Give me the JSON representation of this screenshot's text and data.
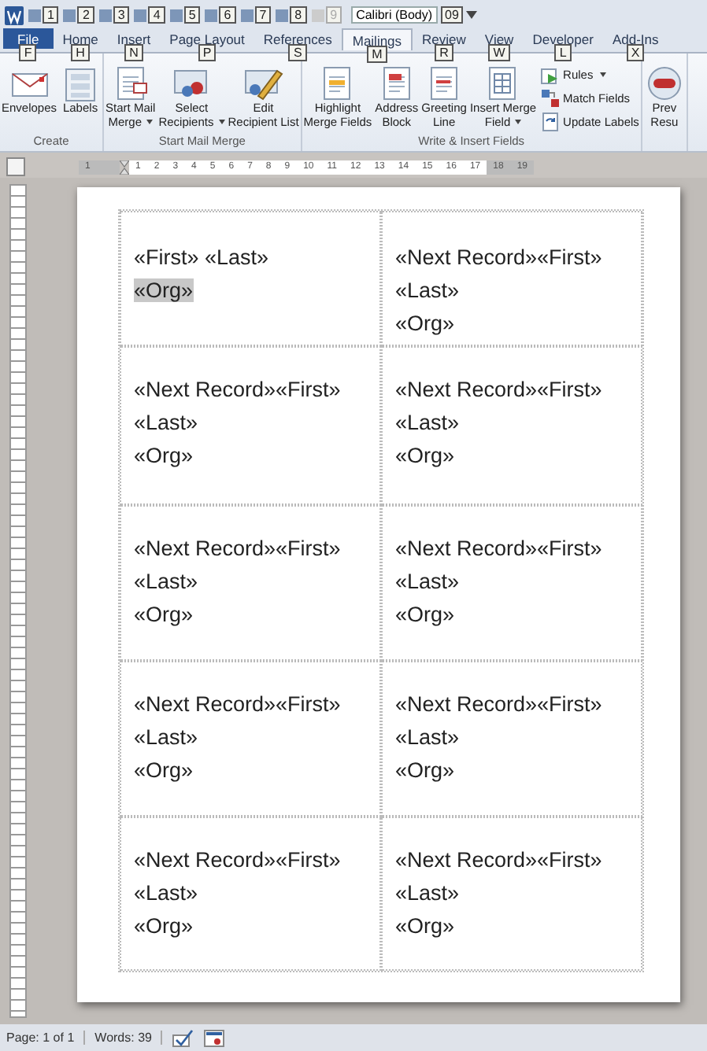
{
  "quick_access": {
    "keytips": [
      {
        "text": "1",
        "disabled": false
      },
      {
        "text": "2",
        "disabled": false
      },
      {
        "text": "3",
        "disabled": false
      },
      {
        "text": "4",
        "disabled": false
      },
      {
        "text": "5",
        "disabled": false
      },
      {
        "text": "6",
        "disabled": false
      },
      {
        "text": "7",
        "disabled": false
      },
      {
        "text": "8",
        "disabled": false
      },
      {
        "text": "9",
        "disabled": true
      }
    ],
    "font_box": {
      "value": "Calibri (Body)",
      "keytip": "09"
    }
  },
  "tabs": [
    {
      "label": "File",
      "keytip": "F",
      "kind": "file",
      "selected": false
    },
    {
      "label": "Home",
      "keytip": "H",
      "kind": "tab",
      "selected": false
    },
    {
      "label": "Insert",
      "keytip": "N",
      "kind": "tab",
      "selected": false
    },
    {
      "label": "Page Layout",
      "keytip": "P",
      "kind": "tab",
      "selected": false
    },
    {
      "label": "References",
      "keytip": "S",
      "kind": "tab",
      "selected": false
    },
    {
      "label": "Mailings",
      "keytip": "M",
      "kind": "tab",
      "selected": true
    },
    {
      "label": "Review",
      "keytip": "R",
      "kind": "tab",
      "selected": false
    },
    {
      "label": "View",
      "keytip": "W",
      "kind": "tab",
      "selected": false
    },
    {
      "label": "Developer",
      "keytip": "L",
      "kind": "tab",
      "selected": false
    },
    {
      "label": "Add-Ins",
      "keytip": "X",
      "kind": "tab",
      "selected": false
    }
  ],
  "ribbon_groups": [
    {
      "label": "Create",
      "buttons": [
        {
          "kind": "large",
          "lines": [
            "Envelopes"
          ],
          "dropdown": false
        },
        {
          "kind": "large",
          "lines": [
            "Labels"
          ],
          "dropdown": false
        }
      ]
    },
    {
      "label": "Start Mail Merge",
      "buttons": [
        {
          "kind": "large",
          "lines": [
            "Start Mail",
            "Merge"
          ],
          "dropdown": true
        },
        {
          "kind": "large",
          "lines": [
            "Select",
            "Recipients"
          ],
          "dropdown": true
        },
        {
          "kind": "large",
          "lines": [
            "Edit",
            "Recipient List"
          ],
          "dropdown": false
        }
      ]
    },
    {
      "label": "Write & Insert Fields",
      "buttons": [
        {
          "kind": "large",
          "lines": [
            "Highlight",
            "Merge Fields"
          ],
          "dropdown": false
        },
        {
          "kind": "large",
          "lines": [
            "Address",
            "Block"
          ],
          "dropdown": false
        },
        {
          "kind": "large",
          "lines": [
            "Greeting",
            "Line"
          ],
          "dropdown": false
        },
        {
          "kind": "large",
          "lines": [
            "Insert Merge",
            "Field"
          ],
          "dropdown": true
        },
        {
          "kind": "small",
          "lines": [
            "Rules"
          ],
          "dropdown": true
        },
        {
          "kind": "small",
          "lines": [
            "Match Fields"
          ],
          "dropdown": false
        },
        {
          "kind": "small",
          "lines": [
            "Update Labels"
          ],
          "dropdown": false
        }
      ]
    },
    {
      "buttons": [
        {
          "kind": "large",
          "lines": [
            "Prev",
            "Resu"
          ],
          "dropdown": false
        }
      ]
    }
  ],
  "ruler": {
    "numbers": [
      "1",
      "1",
      "2",
      "3",
      "4",
      "5",
      "6",
      "7",
      "8",
      "9",
      "10",
      "11",
      "12",
      "13",
      "14",
      "15",
      "16",
      "17",
      "18",
      "19"
    ]
  },
  "labels_table": {
    "rows": [
      [
        {
          "lines": [
            {
              "text": "«First» «Last»",
              "selected": false
            },
            {
              "text": "«Org»",
              "selected": true
            }
          ]
        },
        {
          "lines": [
            {
              "text": "«Next Record»«First»",
              "selected": false
            },
            {
              "text": "«Last»",
              "selected": false
            },
            {
              "text": "«Org»",
              "selected": false
            }
          ]
        }
      ],
      [
        {
          "lines": [
            {
              "text": "«Next Record»«First»",
              "selected": false
            },
            {
              "text": "«Last»",
              "selected": false
            },
            {
              "text": "«Org»",
              "selected": false
            }
          ]
        },
        {
          "lines": [
            {
              "text": "«Next Record»«First»",
              "selected": false
            },
            {
              "text": "«Last»",
              "selected": false
            },
            {
              "text": "«Org»",
              "selected": false
            }
          ]
        }
      ],
      [
        {
          "lines": [
            {
              "text": "«Next Record»«First»",
              "selected": false
            },
            {
              "text": "«Last»",
              "selected": false
            },
            {
              "text": "«Org»",
              "selected": false
            }
          ]
        },
        {
          "lines": [
            {
              "text": "«Next Record»«First»",
              "selected": false
            },
            {
              "text": "«Last»",
              "selected": false
            },
            {
              "text": "«Org»",
              "selected": false
            }
          ]
        }
      ],
      [
        {
          "lines": [
            {
              "text": "«Next Record»«First»",
              "selected": false
            },
            {
              "text": "«Last»",
              "selected": false
            },
            {
              "text": "«Org»",
              "selected": false
            }
          ]
        },
        {
          "lines": [
            {
              "text": "«Next Record»«First»",
              "selected": false
            },
            {
              "text": "«Last»",
              "selected": false
            },
            {
              "text": "«Org»",
              "selected": false
            }
          ]
        }
      ],
      [
        {
          "lines": [
            {
              "text": "«Next Record»«First»",
              "selected": false
            },
            {
              "text": "«Last»",
              "selected": false
            },
            {
              "text": "«Org»",
              "selected": false
            }
          ]
        },
        {
          "lines": [
            {
              "text": "«Next Record»«First»",
              "selected": false
            },
            {
              "text": "«Last»",
              "selected": false
            },
            {
              "text": "«Org»",
              "selected": false
            }
          ]
        }
      ]
    ]
  },
  "status_bar": {
    "items": [
      "Page: 1 of 1",
      "Words: 39"
    ]
  }
}
